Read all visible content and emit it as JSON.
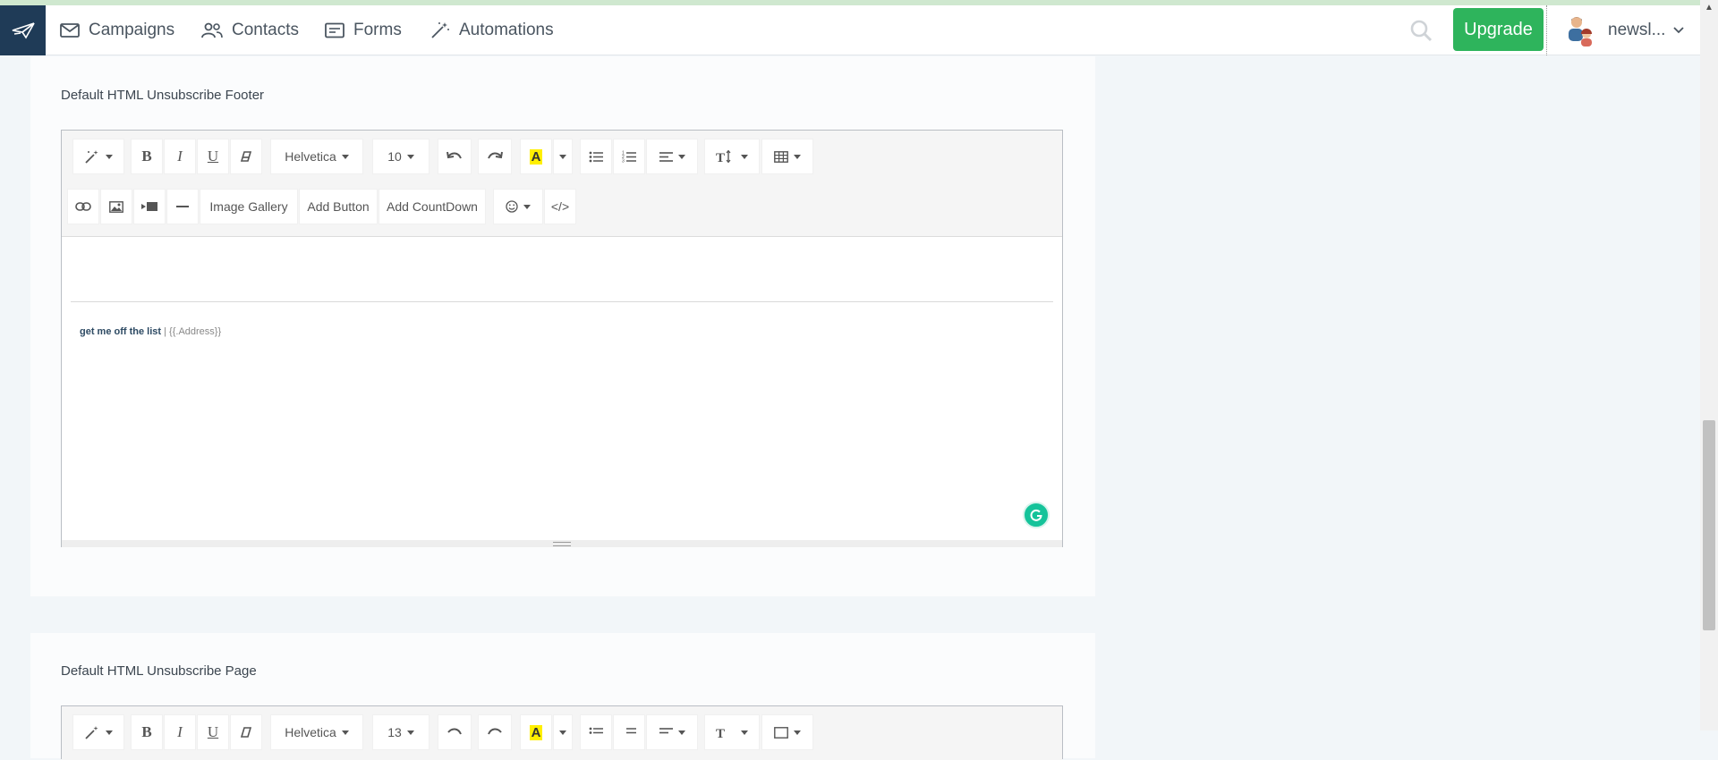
{
  "nav": {
    "items": [
      {
        "label": "Campaigns",
        "icon": "mail-icon"
      },
      {
        "label": "Contacts",
        "icon": "users-icon"
      },
      {
        "label": "Forms",
        "icon": "form-icon"
      },
      {
        "label": "Automations",
        "icon": "magic-wand-icon"
      }
    ],
    "upgrade_label": "Upgrade",
    "account_name": "newsl...",
    "accent_color": "#2eb45c",
    "logo_bg": "#1f3b57"
  },
  "sections": [
    {
      "title": "Default HTML Unsubscribe Footer",
      "toolbar": {
        "font_family": "Helvetica",
        "font_size": "10",
        "image_gallery_label": "Image Gallery",
        "add_button_label": "Add Button",
        "add_countdown_label": "Add CountDown",
        "code_view_label": "</>"
      },
      "content": {
        "link_text": "get me off the list",
        "separator": " | ",
        "template_var": "{{.Address}}"
      }
    },
    {
      "title": "Default HTML Unsubscribe Page",
      "toolbar": {
        "font_family": "Helvetica",
        "font_size": "13"
      }
    }
  ]
}
